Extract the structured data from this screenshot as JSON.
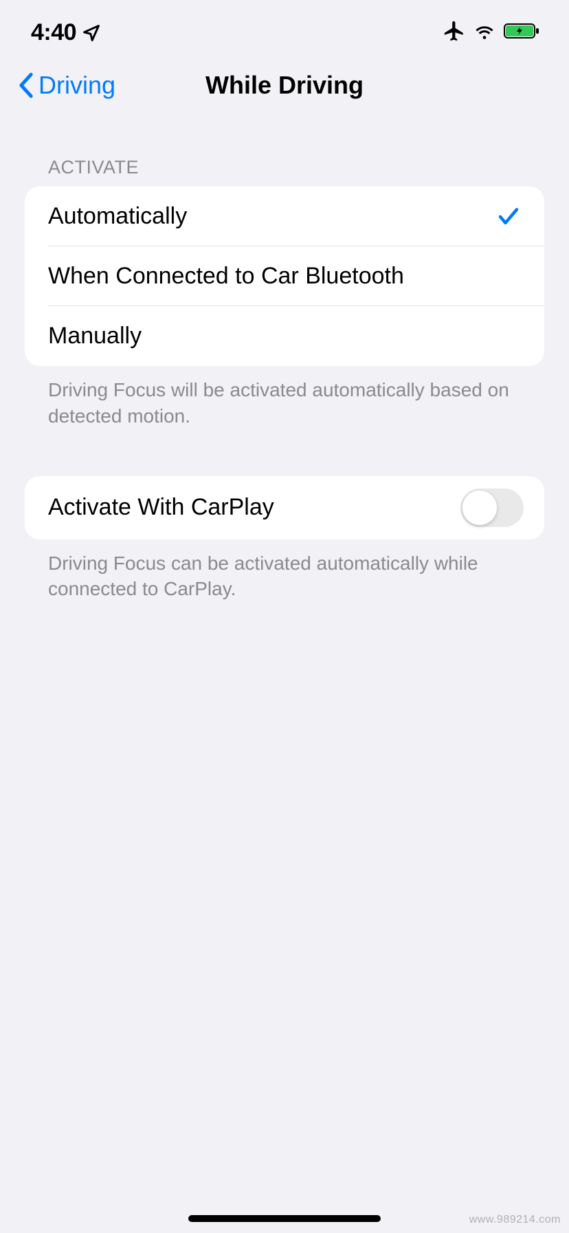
{
  "status_bar": {
    "time": "4:40"
  },
  "nav": {
    "back_label": "Driving",
    "title": "While Driving"
  },
  "activate_section": {
    "header": "ACTIVATE",
    "options": [
      {
        "label": "Automatically",
        "selected": true
      },
      {
        "label": "When Connected to Car Bluetooth",
        "selected": false
      },
      {
        "label": "Manually",
        "selected": false
      }
    ],
    "footer": "Driving Focus will be activated automatically based on detected motion."
  },
  "carplay_section": {
    "label": "Activate With CarPlay",
    "enabled": false,
    "footer": "Driving Focus can be activated automatically while connected to CarPlay."
  },
  "watermark": "www.989214.com"
}
